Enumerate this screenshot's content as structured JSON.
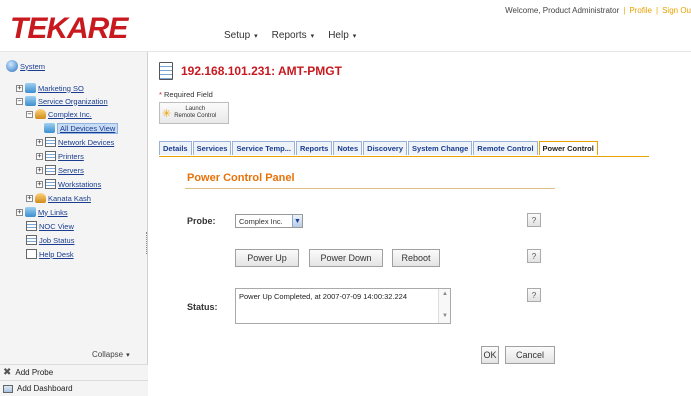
{
  "header": {
    "logo": "TEKARE",
    "nav": [
      {
        "label": "Setup",
        "caret": "▾"
      },
      {
        "label": "Reports",
        "caret": "▾"
      },
      {
        "label": "Help",
        "caret": "▾"
      }
    ],
    "welcome": "Welcome, Product Administrator",
    "separator": "|",
    "profile": "Profile",
    "signout": "Sign Ou"
  },
  "sidebar": {
    "tree": [
      {
        "label": "System",
        "icon": "globe-icon",
        "expander": ""
      },
      {
        "label": "Marketing SO",
        "icon": "folder-icon",
        "expander": "+"
      },
      {
        "label": "Service Organization",
        "icon": "folder-icon",
        "expander": "−"
      },
      {
        "label": "Complex Inc.",
        "icon": "org-icon",
        "expander": "−"
      },
      {
        "label": "All Devices View",
        "icon": "folder-icon",
        "expander": "",
        "selected": true
      },
      {
        "label": "Network Devices",
        "icon": "dev-icon",
        "expander": "+"
      },
      {
        "label": "Printers",
        "icon": "dev-icon",
        "expander": "+"
      },
      {
        "label": "Servers",
        "icon": "dev-icon",
        "expander": "+"
      },
      {
        "label": "Workstations",
        "icon": "dev-icon",
        "expander": "+"
      },
      {
        "label": "Kanata Kash",
        "icon": "org-icon",
        "expander": "+"
      },
      {
        "label": "My Links",
        "icon": "folder-icon",
        "expander": "+"
      },
      {
        "label": "NOC View",
        "icon": "dev-icon",
        "expander": ""
      },
      {
        "label": "Job Status",
        "icon": "dev-icon",
        "expander": ""
      },
      {
        "label": "Help Desk",
        "icon": "doc-icon",
        "expander": ""
      }
    ],
    "collapse_label": "Collapse",
    "collapse_caret": "▾",
    "actions": [
      {
        "label": "Add Probe",
        "icon": "x-icon"
      },
      {
        "label": "Add Dashboard",
        "icon": "dashboard-icon"
      }
    ]
  },
  "main": {
    "device_title": "192.168.101.231: AMT-PMGT",
    "required_star": "*",
    "required_label": "Required Field",
    "launch_line1": "Launch",
    "launch_line2": "Remote Control",
    "tabs": [
      {
        "label": "Details"
      },
      {
        "label": "Services"
      },
      {
        "label": "Service Temp..."
      },
      {
        "label": "Reports"
      },
      {
        "label": "Notes"
      },
      {
        "label": "Discovery"
      },
      {
        "label": "System Change"
      },
      {
        "label": "Remote Control"
      },
      {
        "label": "Power Control",
        "active": true
      }
    ],
    "panel_title": "Power Control Panel",
    "probe_label": "Probe:",
    "probe_value": "Complex Inc.",
    "help": "?",
    "buttons": {
      "power_up": "Power Up",
      "power_down": "Power Down",
      "reboot": "Reboot"
    },
    "status_label": "Status:",
    "status_text": "Power Up Completed,  at 2007-07-09 14:00:32.224",
    "ok": "OK",
    "cancel": "Cancel"
  },
  "colors": {
    "brand_red": "#c8191f",
    "accent_orange": "#e8a200",
    "link_blue": "#1a3d8f"
  }
}
